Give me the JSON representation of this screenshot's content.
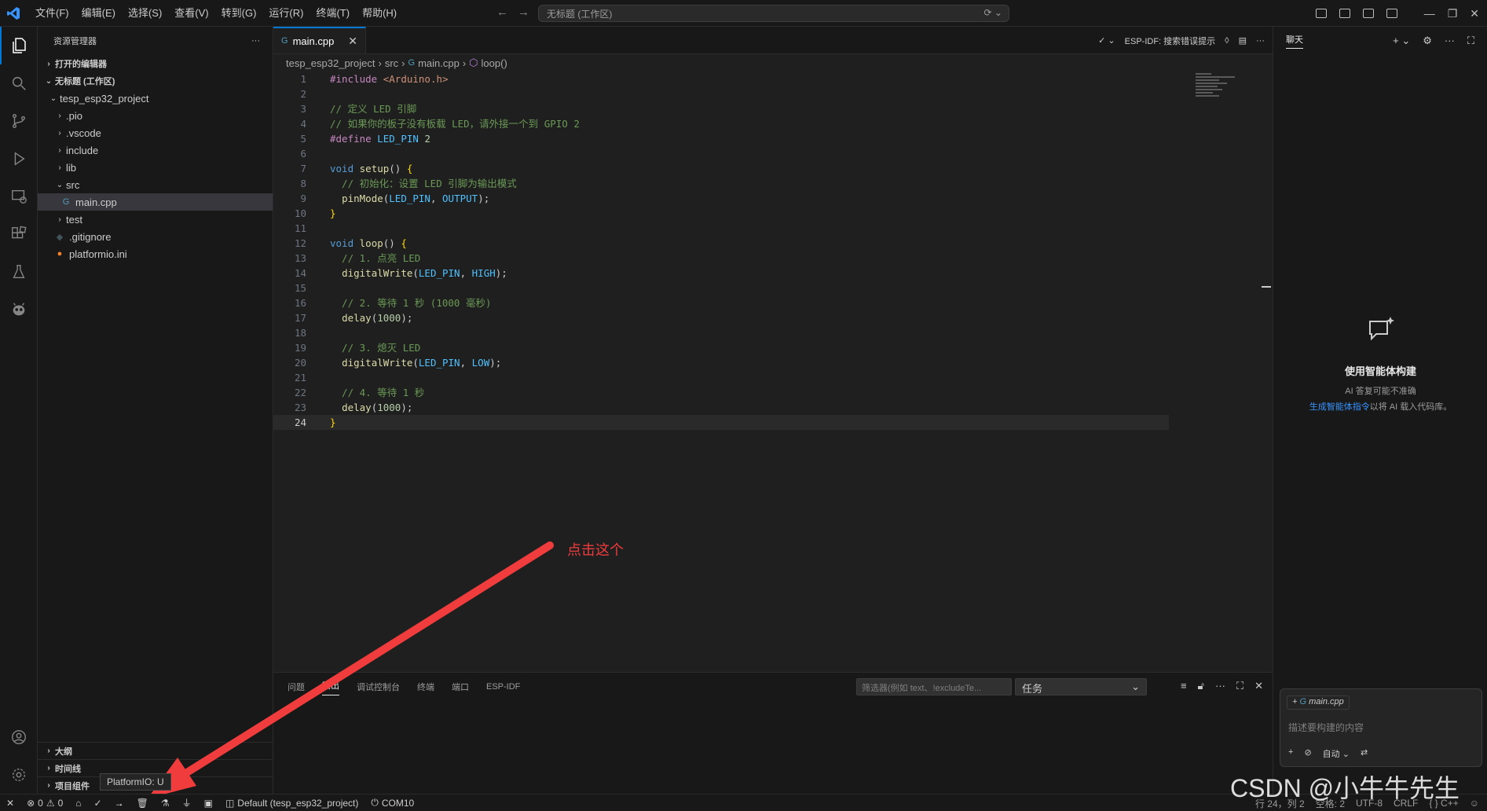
{
  "titlebar": {
    "menu": [
      "文件(F)",
      "编辑(E)",
      "选择(S)",
      "查看(V)",
      "转到(G)",
      "运行(R)",
      "终端(T)",
      "帮助(H)"
    ],
    "command_center": "无标题 (工作区)"
  },
  "sidebar": {
    "title": "资源管理器",
    "more": "···",
    "open_editors": "打开的编辑器",
    "workspace": "无标题 (工作区)",
    "project": "tesp_esp32_project",
    "tree": [
      {
        "label": ".pio",
        "kind": "folder"
      },
      {
        "label": ".vscode",
        "kind": "folder"
      },
      {
        "label": "include",
        "kind": "folder"
      },
      {
        "label": "lib",
        "kind": "folder"
      },
      {
        "label": "src",
        "kind": "folder-open"
      },
      {
        "label": "main.cpp",
        "kind": "file-cpp"
      },
      {
        "label": "test",
        "kind": "folder"
      },
      {
        "label": ".gitignore",
        "kind": "file-git"
      },
      {
        "label": "platformio.ini",
        "kind": "file-ini"
      }
    ],
    "outline": "大纲",
    "timeline": "时间线",
    "project_tasks": "项目组件"
  },
  "editor": {
    "tab_label": "main.cpp",
    "actions_label": "ESP-IDF: 搜索错误提示",
    "breadcrumb": [
      "tesp_esp32_project",
      "src",
      "main.cpp",
      "loop()"
    ],
    "lines": [
      "#include <Arduino.h>",
      "",
      "// 定义 LED 引脚",
      "// 如果你的板子没有板载 LED，请外接一个到 GPIO 2",
      "#define LED_PIN 2",
      "",
      "void setup() {",
      "  // 初始化：设置 LED 引脚为输出模式",
      "  pinMode(LED_PIN, OUTPUT);",
      "}",
      "",
      "void loop() {",
      "  // 1. 点亮 LED",
      "  digitalWrite(LED_PIN, HIGH);",
      "",
      "  // 2. 等待 1 秒 (1000 毫秒)",
      "  delay(1000);",
      "",
      "  // 3. 熄灭 LED",
      "  digitalWrite(LED_PIN, LOW);",
      "",
      "  // 4. 等待 1 秒",
      "  delay(1000);",
      "}"
    ],
    "current_line": 24
  },
  "annotation": {
    "text": "点击这个",
    "color": "#f03c3c"
  },
  "panel": {
    "tabs": [
      "问题",
      "输出",
      "调试控制台",
      "终端",
      "端口",
      "ESP-IDF"
    ],
    "active_tab": "输出",
    "filter_placeholder": "筛选器(例如 text、!excludeTe...",
    "select_value": "任务"
  },
  "chat": {
    "title": "聊天",
    "heading": "使用智能体构建",
    "subtitle": "AI 答复可能不准确",
    "link": "生成智能体指令",
    "link_suffix": "以将 AI 载入代码库。",
    "context_chip": "main.cpp",
    "input_placeholder": "描述要构建的内容",
    "mode": "自动"
  },
  "statusbar": {
    "errors": "0",
    "warnings": "0",
    "env": "Default (tesp_esp32_project)",
    "port": "COM10",
    "tooltip": "PlatformIO: U",
    "position": "行 24，列 2",
    "spaces": "空格: 2",
    "encoding": "UTF-8",
    "eol": "CRLF",
    "language": "C++"
  },
  "watermark": "CSDN @小牛牛先生",
  "colors": {
    "accent": "#0078d4",
    "background": "#1f1f1f",
    "sidebar": "#181818"
  }
}
